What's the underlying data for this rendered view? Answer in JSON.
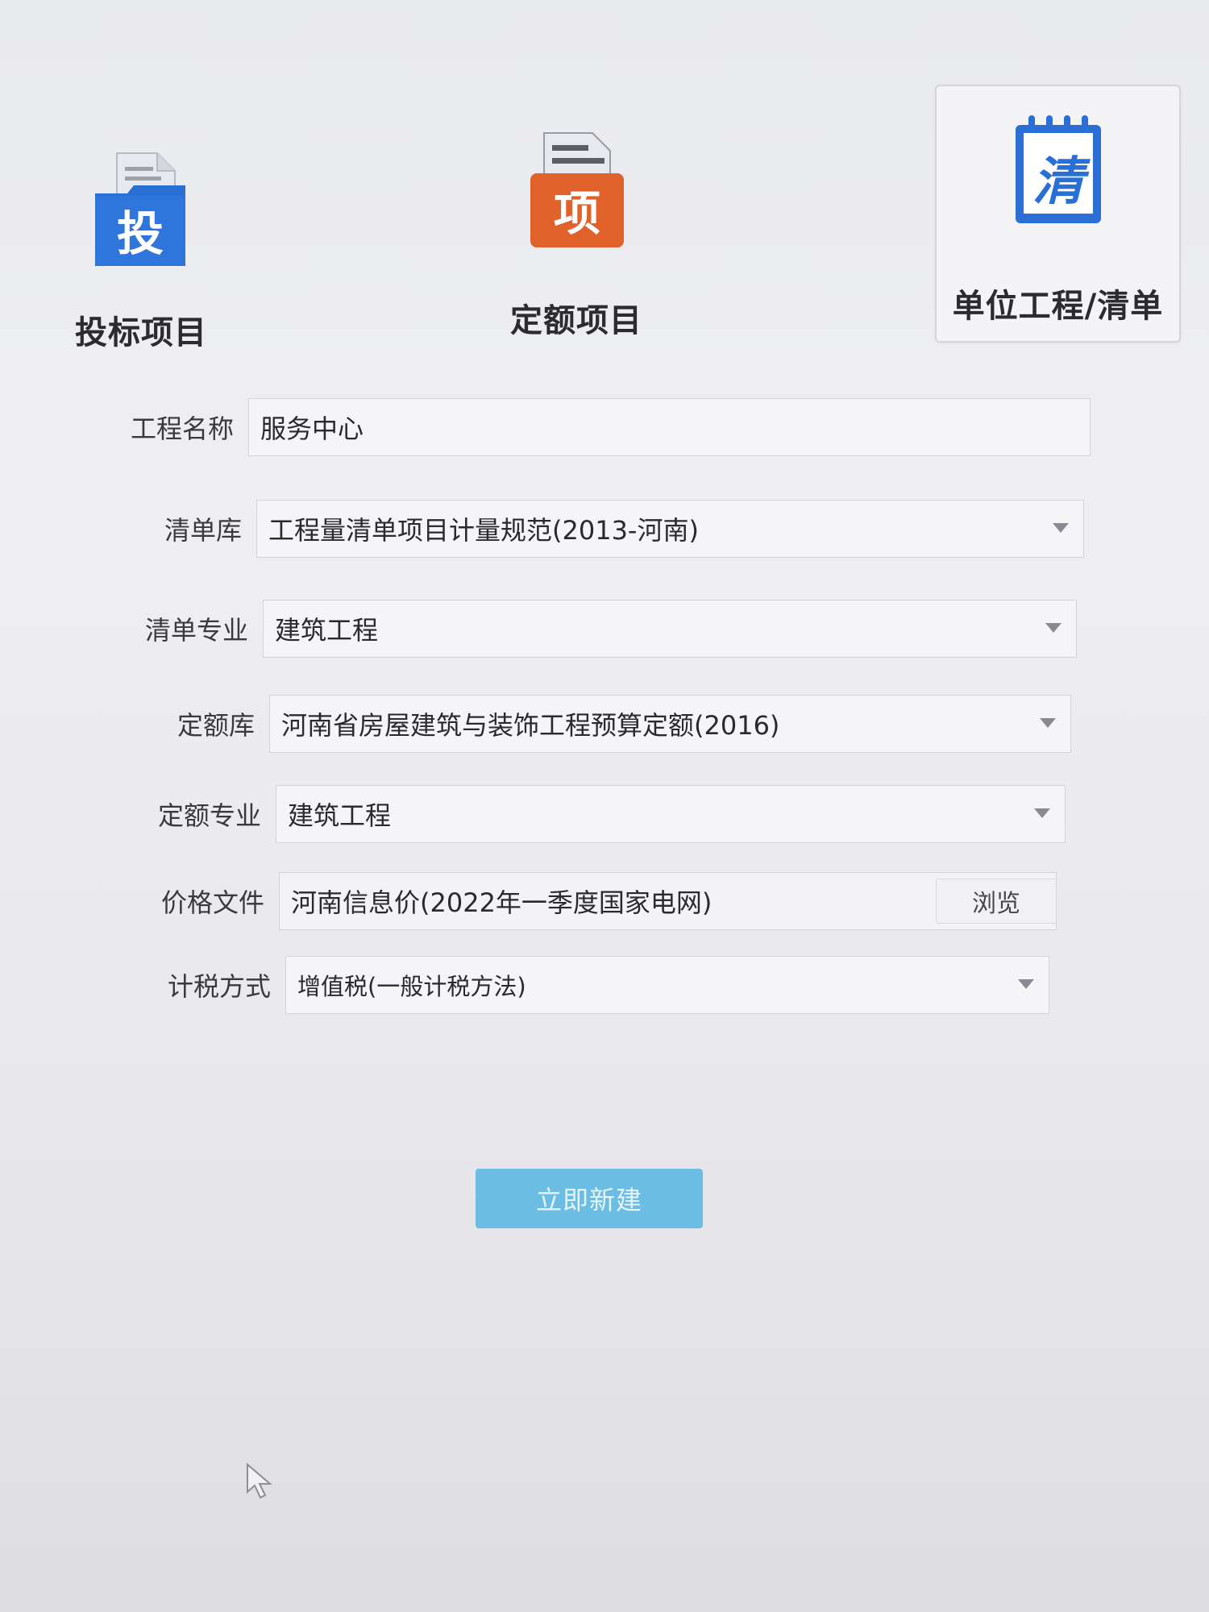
{
  "tabs": [
    {
      "label": "投标项目",
      "icon_char": "投",
      "icon_name": "bid-folder-icon",
      "color": "#2a6fd6",
      "selected": false
    },
    {
      "label": "定额项目",
      "icon_char": "项",
      "icon_name": "quota-folder-icon",
      "color": "#e0622a",
      "selected": false
    },
    {
      "label": "单位工程/清单",
      "icon_char": "清",
      "icon_name": "bill-notebook-icon",
      "color": "#2a6fd6",
      "selected": true
    }
  ],
  "form": {
    "project_name": {
      "label": "工程名称",
      "value": "服务中心"
    },
    "bill_library": {
      "label": "清单库",
      "value": "工程量清单项目计量规范(2013-河南)"
    },
    "bill_specialty": {
      "label": "清单专业",
      "value": "建筑工程"
    },
    "quota_library": {
      "label": "定额库",
      "value": "河南省房屋建筑与装饰工程预算定额(2016)"
    },
    "quota_specialty": {
      "label": "定额专业",
      "value": "建筑工程"
    },
    "price_file": {
      "label": "价格文件",
      "value": "河南信息价(2022年一季度国家电网)",
      "browse_label": "浏览"
    },
    "tax_method": {
      "label": "计税方式",
      "value": "增值税(一般计税方法)"
    }
  },
  "submit_label": "立即新建",
  "colors": {
    "accent": "#6cbde3",
    "blue_icon": "#2a6fd6",
    "orange_icon": "#e0622a"
  }
}
